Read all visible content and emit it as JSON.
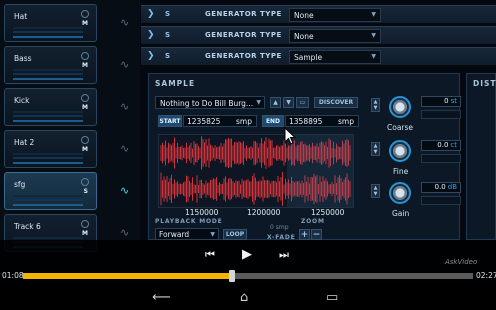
{
  "tracks": [
    {
      "name": "Hat",
      "selected": false
    },
    {
      "name": "Bass",
      "selected": false
    },
    {
      "name": "Kick",
      "selected": false
    },
    {
      "name": "Hat 2",
      "selected": false
    },
    {
      "name": "sfg",
      "selected": true
    },
    {
      "name": "Track 6",
      "selected": false
    }
  ],
  "track_badge": "M",
  "track_badge_sfg": "S",
  "generators": [
    {
      "s": "S",
      "label": "GENERATOR TYPE",
      "value": "None"
    },
    {
      "s": "S",
      "label": "GENERATOR TYPE",
      "value": "None"
    },
    {
      "s": "S",
      "label": "GENERATOR TYPE",
      "value": "Sample"
    }
  ],
  "sample": {
    "title": "SAMPLE",
    "file": "Nothing to Do Bill Burg...",
    "discover": "DISCOVER",
    "start_label": "START",
    "start_value": "1235825",
    "start_unit": "smp",
    "end_label": "END",
    "end_value": "1358895",
    "end_unit": "smp",
    "ruler": [
      "1150000",
      "1200000",
      "1250000"
    ],
    "playback_mode_label": "PLAYBACK MODE",
    "playback_mode": "Forward",
    "loop": "LOOP",
    "xfade_value": "0",
    "xfade_unit": "smp",
    "xfade_label": "X-FADE",
    "zoom_label": "ZOOM",
    "zoom_in": "+",
    "zoom_out": "−"
  },
  "knobs": [
    {
      "label": "Coarse",
      "value": "0",
      "unit": "st"
    },
    {
      "label": "Fine",
      "value": "0.0",
      "unit": "ct"
    },
    {
      "label": "Gain",
      "value": "0.0",
      "unit": "dB"
    }
  ],
  "distortion_title": "DISTO",
  "player": {
    "elapsed": "01:08",
    "duration": "02:27",
    "progress": 0.465,
    "brand": "AskVideo"
  },
  "colors": {
    "progress": "#f1b400",
    "accent": "#2794d8",
    "waveform": "#d0323a"
  }
}
